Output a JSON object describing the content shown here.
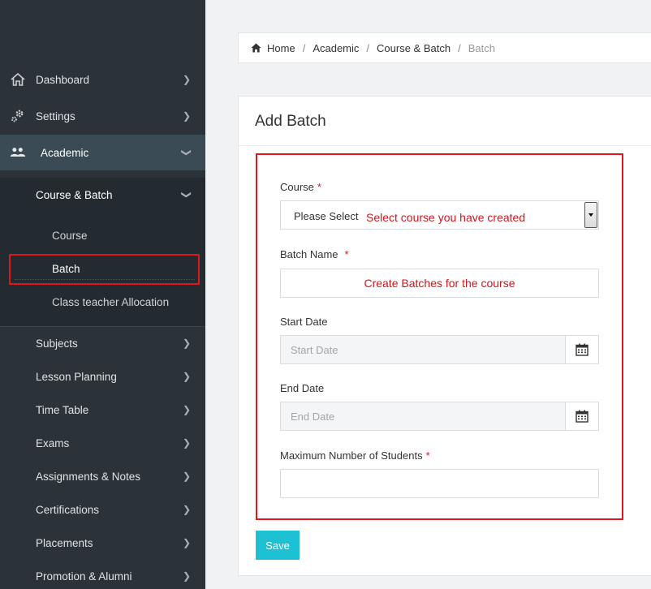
{
  "sidebar": {
    "dashboard": {
      "label": "Dashboard",
      "icon": "home-icon"
    },
    "settings": {
      "label": "Settings",
      "icon": "gears-icon"
    },
    "academic": {
      "label": "Academic",
      "icon": "users-icon"
    },
    "course_batch": {
      "label": "Course & Batch"
    },
    "sub_links": {
      "course": "Course",
      "batch": "Batch",
      "class_teacher": "Class teacher Allocation"
    },
    "items": [
      {
        "label": "Subjects"
      },
      {
        "label": "Lesson Planning"
      },
      {
        "label": "Time Table"
      },
      {
        "label": "Exams"
      },
      {
        "label": "Assignments & Notes"
      },
      {
        "label": "Certifications"
      },
      {
        "label": "Placements"
      },
      {
        "label": "Promotion & Alumni"
      }
    ]
  },
  "breadcrumb": {
    "home": "Home",
    "academic": "Academic",
    "course_batch": "Course & Batch",
    "current": "Batch",
    "separator": "/"
  },
  "form": {
    "title": "Add Batch",
    "required_mark": "*",
    "course": {
      "label": "Course",
      "selected": "Please Select",
      "annotation": "Select course you have created"
    },
    "batch_name": {
      "label": "Batch Name",
      "placeholder": "Create Batches for the course"
    },
    "start_date": {
      "label": "Start Date",
      "placeholder": "Start Date"
    },
    "end_date": {
      "label": "End Date",
      "placeholder": "End Date"
    },
    "max_students": {
      "label": "Maximum Number of Students",
      "placeholder": ""
    },
    "save_label": "Save"
  },
  "colors": {
    "sidebar_bg": "#2b3339",
    "active_bg": "#3b4b56",
    "accent": "#1ec1d4",
    "annotation": "#e0161c"
  }
}
